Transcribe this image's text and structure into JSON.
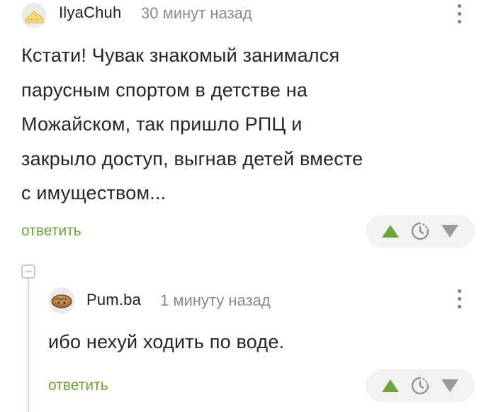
{
  "comment": {
    "username": "IlyaChuh",
    "time": "30 минут назад",
    "avatar_icon": "cheese-avatar",
    "body_lines": [
      "Кстати! Чувак знакомый занимался",
      "парусным спортом в детстве на",
      "Можайском, так пришло РПЦ и",
      "закрыло доступ, выгнав детей вместе",
      "с имуществом..."
    ],
    "reply_label": "ответить",
    "actions": {
      "upvote_icon": "upvote-icon",
      "save_icon": "clock-icon",
      "downvote_icon": "downvote-icon"
    }
  },
  "reply": {
    "username": "Pum.ba",
    "time": "1 минуту назад",
    "avatar_icon": "bread-avatar",
    "body": "ибо нехуй ходить по воде.",
    "reply_label": "ответить",
    "actions": {
      "upvote_icon": "upvote-icon",
      "save_icon": "clock-icon",
      "downvote_icon": "downvote-icon"
    }
  },
  "colors": {
    "accent_green": "#6ea33a",
    "upvote_green": "#6ea33a",
    "downvote_gray": "#9a9a9a",
    "meta_gray": "#8a8a8a"
  }
}
